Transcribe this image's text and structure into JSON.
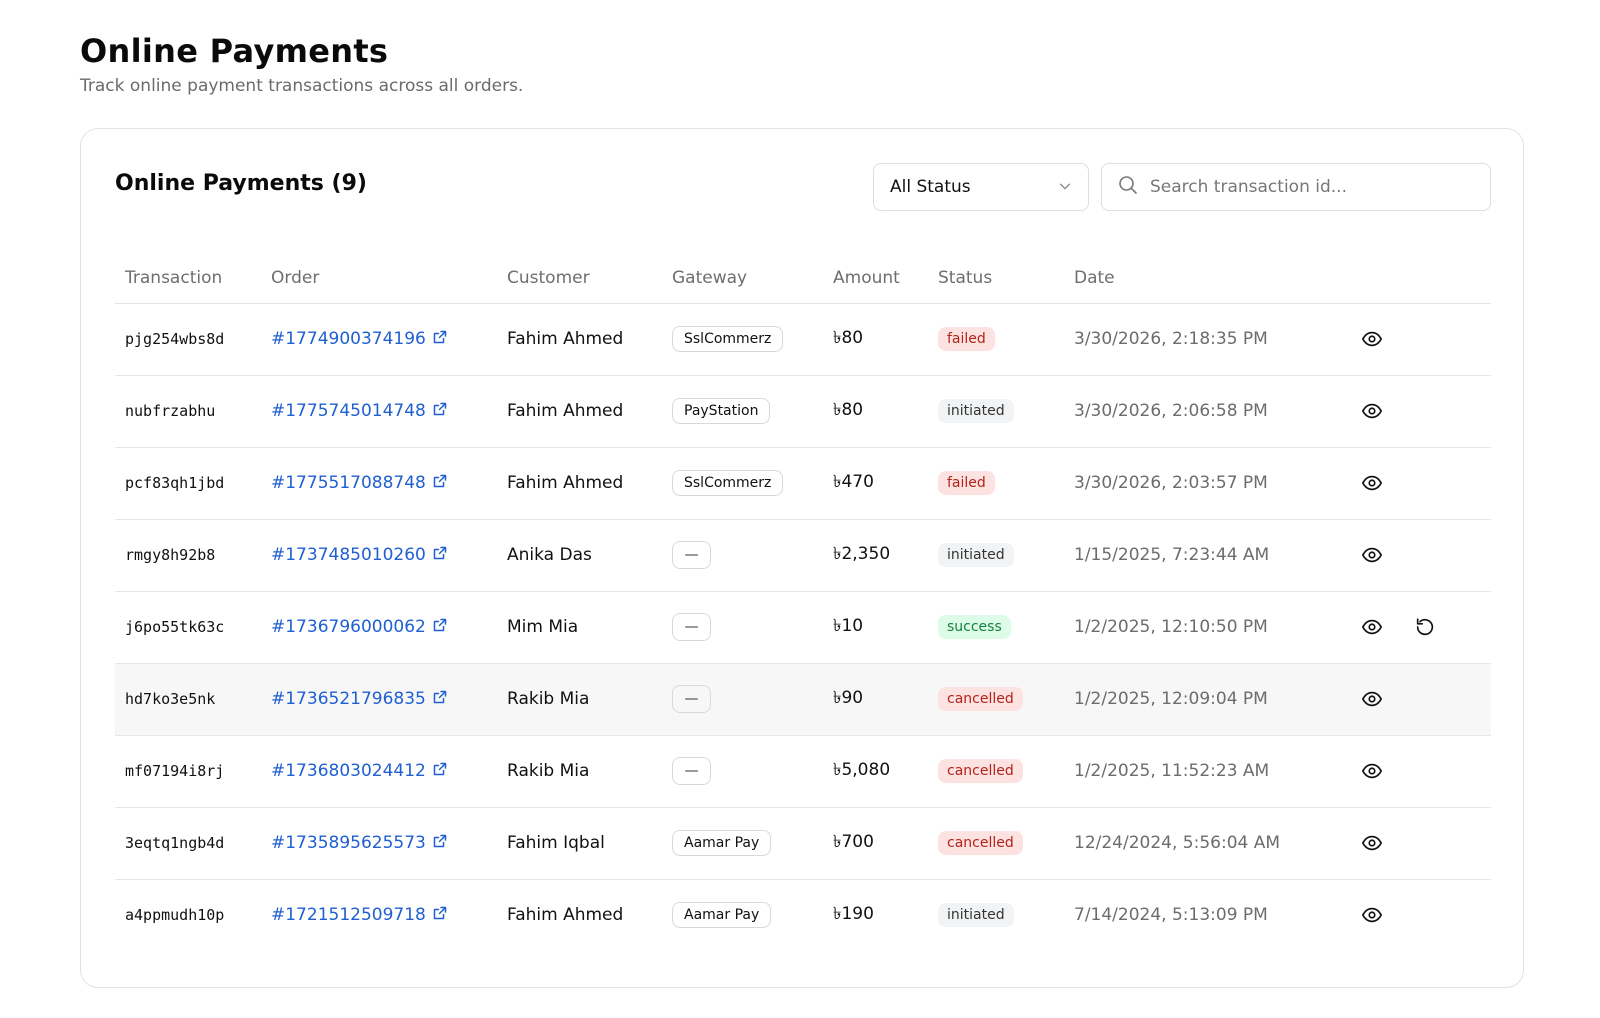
{
  "page": {
    "title": "Online Payments",
    "subtitle": "Track online payment transactions across all orders."
  },
  "card": {
    "title": "Online Payments (9)"
  },
  "filters": {
    "status_value": "All Status",
    "search_placeholder": "Search transaction id..."
  },
  "table": {
    "columns": [
      "Transaction",
      "Order",
      "Customer",
      "Gateway",
      "Amount",
      "Status",
      "Date"
    ],
    "rows": [
      {
        "transaction": "pjg254wbs8d",
        "order": "#1774900374196",
        "customer": "Fahim Ahmed",
        "gateway": "SslCommerz",
        "amount": "৳80",
        "status": "failed",
        "date": "3/30/2026, 2:18:35 PM",
        "refund": false
      },
      {
        "transaction": "nubfrzabhu",
        "order": "#1775745014748",
        "customer": "Fahim Ahmed",
        "gateway": "PayStation",
        "amount": "৳80",
        "status": "initiated",
        "date": "3/30/2026, 2:06:58 PM",
        "refund": false
      },
      {
        "transaction": "pcf83qh1jbd",
        "order": "#1775517088748",
        "customer": "Fahim Ahmed",
        "gateway": "SslCommerz",
        "amount": "৳470",
        "status": "failed",
        "date": "3/30/2026, 2:03:57 PM",
        "refund": false
      },
      {
        "transaction": "rmgy8h92b8",
        "order": "#1737485010260",
        "customer": "Anika Das",
        "gateway": "—",
        "amount": "৳2,350",
        "status": "initiated",
        "date": "1/15/2025, 7:23:44 AM",
        "refund": false
      },
      {
        "transaction": "j6po55tk63c",
        "order": "#1736796000062",
        "customer": "Mim Mia",
        "gateway": "—",
        "amount": "৳10",
        "status": "success",
        "date": "1/2/2025, 12:10:50 PM",
        "refund": true
      },
      {
        "transaction": "hd7ko3e5nk",
        "order": "#1736521796835",
        "customer": "Rakib Mia",
        "gateway": "—",
        "amount": "৳90",
        "status": "cancelled",
        "date": "1/2/2025, 12:09:04 PM",
        "refund": false
      },
      {
        "transaction": "mf07194i8rj",
        "order": "#1736803024412",
        "customer": "Rakib Mia",
        "gateway": "—",
        "amount": "৳5,080",
        "status": "cancelled",
        "date": "1/2/2025, 11:52:23 AM",
        "refund": false
      },
      {
        "transaction": "3eqtq1ngb4d",
        "order": "#1735895625573",
        "customer": "Fahim Iqbal",
        "gateway": "Aamar Pay",
        "amount": "৳700",
        "status": "cancelled",
        "date": "12/24/2024, 5:56:04 AM",
        "refund": false
      },
      {
        "transaction": "a4ppmudh10p",
        "order": "#1721512509718",
        "customer": "Fahim Ahmed",
        "gateway": "Aamar Pay",
        "amount": "৳190",
        "status": "initiated",
        "date": "7/14/2024, 5:13:09 PM",
        "refund": false
      }
    ]
  },
  "status_colors": {
    "failed": {
      "bg": "#fde2e2",
      "fg": "#b42318"
    },
    "cancelled": {
      "bg": "#fde2e2",
      "fg": "#b42318"
    },
    "initiated": {
      "bg": "#f2f3f4",
      "fg": "#333333"
    },
    "success": {
      "bg": "#dcfce7",
      "fg": "#15803d"
    }
  },
  "colors": {
    "link": "#1f5fd1"
  },
  "icons": {
    "search": "search-icon",
    "chevron": "chevron-down-icon",
    "external": "external-link-icon",
    "view": "eye-icon",
    "refund": "rotate-ccw-icon"
  }
}
